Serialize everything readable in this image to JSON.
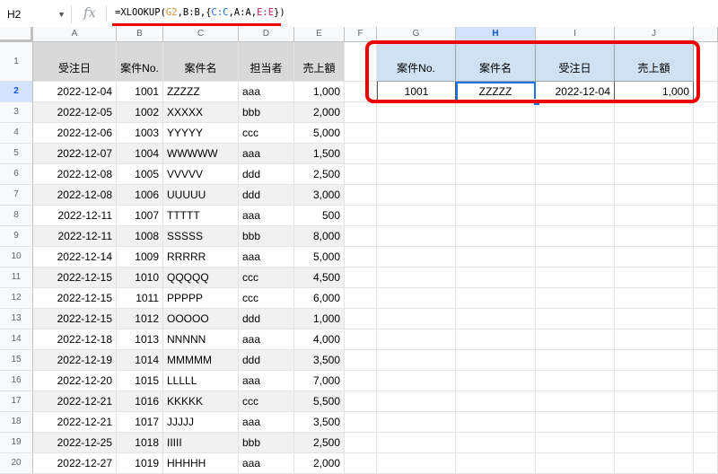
{
  "name_box": "H2",
  "fx_symbol": "fx",
  "formula": {
    "p1": "=XLOOKUP(",
    "g2": "G2",
    "p2": ",B:B,{",
    "cc": "C:C",
    "p3": ",A:A,",
    "ee": "E:E",
    "p4": "})"
  },
  "columns": [
    "A",
    "B",
    "C",
    "D",
    "E",
    "F",
    "G",
    "H",
    "I",
    "J"
  ],
  "headers_left": [
    "受注日",
    "案件No.",
    "案件名",
    "担当者",
    "売上額"
  ],
  "headers_right": [
    "案件No.",
    "案件名",
    "受注日",
    "売上額"
  ],
  "lookup_result": {
    "no": "1001",
    "name": "ZZZZZ",
    "date": "2022-12-04",
    "amount": "1,000"
  },
  "rows": [
    [
      "2",
      "2022-12-04",
      "1001",
      "ZZZZZ",
      "aaa",
      "1,000"
    ],
    [
      "3",
      "2022-12-05",
      "1002",
      "XXXXX",
      "bbb",
      "2,000"
    ],
    [
      "4",
      "2022-12-06",
      "1003",
      "YYYYY",
      "ccc",
      "5,000"
    ],
    [
      "5",
      "2022-12-07",
      "1004",
      "WWWWW",
      "aaa",
      "1,500"
    ],
    [
      "6",
      "2022-12-08",
      "1005",
      "VVVVV",
      "ddd",
      "2,500"
    ],
    [
      "7",
      "2022-12-08",
      "1006",
      "UUUUU",
      "ddd",
      "3,000"
    ],
    [
      "8",
      "2022-12-11",
      "1007",
      "TTTTT",
      "aaa",
      "500"
    ],
    [
      "9",
      "2022-12-11",
      "1008",
      "SSSSS",
      "bbb",
      "8,000"
    ],
    [
      "10",
      "2022-12-14",
      "1009",
      "RRRRR",
      "aaa",
      "5,000"
    ],
    [
      "11",
      "2022-12-15",
      "1010",
      "QQQQQ",
      "ccc",
      "4,500"
    ],
    [
      "12",
      "2022-12-15",
      "1011",
      "PPPPP",
      "ccc",
      "6,000"
    ],
    [
      "13",
      "2022-12-15",
      "1012",
      "OOOOO",
      "ddd",
      "1,000"
    ],
    [
      "14",
      "2022-12-18",
      "1013",
      "NNNNN",
      "aaa",
      "4,000"
    ],
    [
      "15",
      "2022-12-19",
      "1014",
      "MMMMM",
      "ddd",
      "3,500"
    ],
    [
      "16",
      "2022-12-20",
      "1015",
      "LLLLL",
      "aaa",
      "7,000"
    ],
    [
      "17",
      "2022-12-21",
      "1016",
      "KKKKK",
      "ccc",
      "5,500"
    ],
    [
      "18",
      "2022-12-21",
      "1017",
      "JJJJJ",
      "aaa",
      "3,500"
    ],
    [
      "19",
      "2022-12-25",
      "1018",
      "IIIII",
      "bbb",
      "2,500"
    ],
    [
      "20",
      "2022-12-27",
      "1019",
      "HHHHH",
      "aaa",
      "2,000"
    ]
  ]
}
